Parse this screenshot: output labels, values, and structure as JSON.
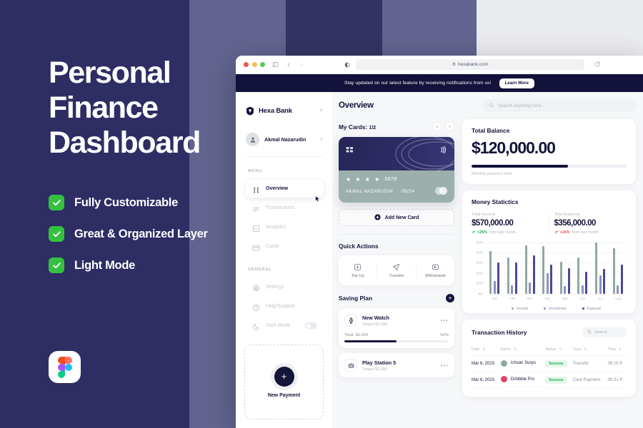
{
  "promo": {
    "headline_lines": [
      "Personal",
      "Finance",
      "Dashboard"
    ],
    "features": [
      {
        "label": "Fully Customizable"
      },
      {
        "label": "Great & Organized Layer"
      },
      {
        "label": "Light Mode"
      }
    ],
    "logo_name": "figma-logo"
  },
  "browser": {
    "url": "hexabank.com",
    "lock_icon": "lock-icon",
    "reload_icon": "reload-icon",
    "back_icon": "chevron-left-icon",
    "forward_icon": "chevron-right-icon",
    "sidebar_icon": "sidebar-toggle-icon",
    "theme_icon": "theme-contrast-icon"
  },
  "banner": {
    "text": "Stay updated on our latest feature by receiving notifications from us!",
    "button": "Learn More"
  },
  "sidebar": {
    "brand": "Hexa Bank",
    "collapse_icon": "chevron-left-icon",
    "profile": {
      "name": "Akmal Nazarudin",
      "avatar_icon": "user-avatar"
    },
    "menu_label": "MENU",
    "menu": [
      {
        "label": "Overview",
        "icon": "grid-icon",
        "active": true
      },
      {
        "label": "Transactions",
        "icon": "list-icon",
        "active": false
      },
      {
        "label": "Analytics",
        "icon": "analytics-icon",
        "active": false
      },
      {
        "label": "Cards",
        "icon": "card-icon",
        "active": false
      }
    ],
    "general_label": "GENERAL",
    "general": [
      {
        "label": "Settings",
        "icon": "gear-icon"
      },
      {
        "label": "Help/Support",
        "icon": "help-icon"
      },
      {
        "label": "Dark Mode",
        "icon": "moon-icon",
        "toggle": true
      }
    ],
    "new_payment": {
      "label": "New Payment",
      "icon": "plus-icon"
    }
  },
  "header": {
    "title": "Overview",
    "search_placeholder": "Search anything here .",
    "search_icon": "search-icon"
  },
  "cards_section": {
    "title": "My Cards:",
    "counter": "1/2",
    "prev_icon": "chevron-left-icon",
    "next_icon": "chevron-right-icon",
    "card": {
      "masked": "★ ★ ★ ★",
      "last4": "5678",
      "holder": "AKMAL NAZARUDIN",
      "expiry": "05/24",
      "chip_icon": "chip-icon",
      "contactless_icon": "contactless-icon"
    },
    "add_card": {
      "label": "Add New Card",
      "icon": "plus-circle-icon"
    }
  },
  "quick_actions": {
    "title": "Quick Actions",
    "items": [
      {
        "label": "Top Up",
        "icon": "plus-square-icon"
      },
      {
        "label": "Transfer",
        "icon": "send-icon"
      },
      {
        "label": "Withdrawal",
        "icon": "withdraw-icon"
      }
    ]
  },
  "saving_plan": {
    "title": "Saving Plan",
    "add_icon": "plus-icon",
    "items": [
      {
        "name": "New Watch",
        "target": "Target $2,000",
        "icon": "watch-icon",
        "total": "Total: $1,000",
        "percent": "50%",
        "progress": 50,
        "more_icon": "more-horizontal-icon",
        "show_progress": true
      },
      {
        "name": "Play Station 5",
        "target": "Target $2,000",
        "icon": "console-icon",
        "total": "",
        "percent": "",
        "progress": 0,
        "more_icon": "more-horizontal-icon",
        "show_progress": false
      }
    ]
  },
  "total_balance": {
    "title": "Total Balance",
    "amount": "$120,000.00",
    "limit_label": "Monthly payment limit",
    "limit_percent": 62
  },
  "money_statistics": {
    "title": "Money Statictics",
    "income": {
      "label": "Total Income",
      "value": "$570,000.00",
      "delta": "+25%",
      "delta_sub": "from last month",
      "direction": "up",
      "arrow_icon": "arrow-up-right-icon"
    },
    "expense": {
      "label": "Total Expense",
      "value": "$356,000.00",
      "delta": "+15%",
      "delta_sub": "from last month",
      "direction": "down",
      "arrow_icon": "arrow-up-right-icon"
    }
  },
  "chart_data": {
    "type": "bar",
    "title": "Money Statictics",
    "xlabel": "",
    "ylabel": "",
    "categories": [
      "Jan",
      "Feb",
      "Mar",
      "Apr",
      "Mei",
      "Jun",
      "Jul",
      "Aug"
    ],
    "series": [
      {
        "name": "Income",
        "color": "#8fa9a4",
        "values": [
          41,
          35,
          47,
          46,
          31,
          35,
          50,
          44
        ]
      },
      {
        "name": "Investment",
        "color": "#8d8fc4",
        "values": [
          12,
          8,
          11,
          20,
          7,
          8,
          18,
          8
        ]
      },
      {
        "name": "Expense",
        "color": "#494a8f",
        "values": [
          30,
          30,
          37,
          28,
          25,
          21,
          24,
          28
        ]
      }
    ],
    "ylim": [
      0,
      50
    ],
    "yticks": [
      "$0K",
      "$10K",
      "$20K",
      "$30K",
      "$40K",
      "$50K"
    ],
    "ytick_values": [
      0,
      10,
      20,
      30,
      40,
      50
    ],
    "grid": true,
    "legend_position": "bottom"
  },
  "transactions": {
    "title": "Transaction History",
    "search_placeholder": "Search",
    "search_icon": "search-icon",
    "columns": [
      "Date",
      "Name",
      "Status",
      "Type",
      "Time"
    ],
    "rows": [
      {
        "date": "Mar 6, 2023",
        "name": "Ichsan Suryo",
        "avatar_color": "#8fa9a4",
        "status": "Success",
        "type": "Transfer",
        "time": "08:15 P"
      },
      {
        "date": "Mar 6, 2023",
        "name": "Dribbble Pro",
        "avatar_color": "#e4406a",
        "status": "Success",
        "type": "Card Payment",
        "time": "06:31 P"
      }
    ]
  }
}
